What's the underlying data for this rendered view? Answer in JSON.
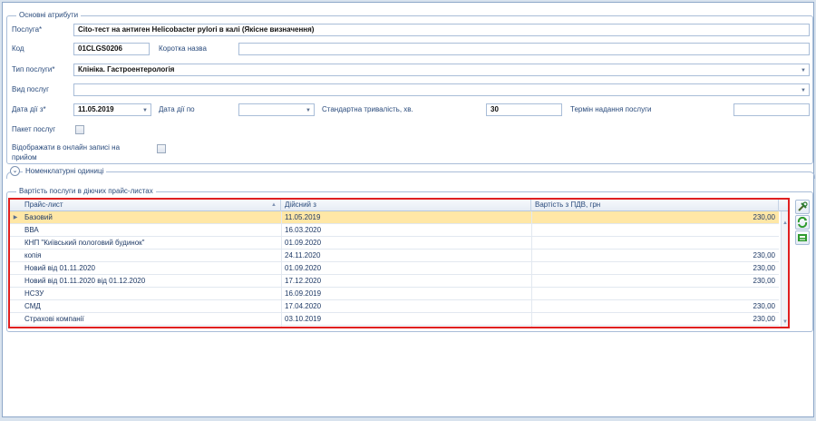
{
  "attributes": {
    "group_title": "Основні атрибути",
    "service": {
      "label": "Послуга*",
      "value": "Cito-тест на антиген Helicobacter pylori в калі (Якісне визначення)"
    },
    "code": {
      "label": "Код",
      "value": "01CLGS0206"
    },
    "short_name": {
      "label": "Коротка назва",
      "value": ""
    },
    "service_type": {
      "label": "Тип послуги*",
      "value": "Клініка. Гастроентерологія"
    },
    "service_kind": {
      "label": "Вид послуг",
      "value": ""
    },
    "date_from": {
      "label": "Дата дії з*",
      "value": "11.05.2019"
    },
    "date_to": {
      "label": "Дата дії по",
      "value": ""
    },
    "std_duration": {
      "label": "Стандартна тривалість, хв.",
      "value": "30"
    },
    "term": {
      "label": "Термін надання послуги",
      "value": ""
    },
    "package": {
      "label": "Пакет послуг",
      "checked": false
    },
    "online": {
      "label_line1": "Відображати в онлайн записі на",
      "label_line2": "прийом",
      "checked": false
    }
  },
  "nomenclature": {
    "title": "Номенклатурні одиниці",
    "icon": "chevron-down-icon"
  },
  "prices": {
    "group_title": "Вартість послуги в діючих прайс-листах",
    "columns": [
      "Прайс-лист",
      "Дійсний з",
      "Вартість з ПДВ, грн"
    ],
    "rows": [
      {
        "name": "Базовий",
        "date": "11.05.2019",
        "price": "230,00",
        "selected": true
      },
      {
        "name": "ВВА",
        "date": "16.03.2020",
        "price": ""
      },
      {
        "name": "КНП \"Київський пологовий будинок\"",
        "date": "01.09.2020",
        "price": ""
      },
      {
        "name": "копія",
        "date": "24.11.2020",
        "price": "230,00"
      },
      {
        "name": "Новий від 01.11.2020",
        "date": "01.09.2020",
        "price": "230,00"
      },
      {
        "name": "Новий від 01.11.2020 від 01.12.2020",
        "date": "17.12.2020",
        "price": "230,00"
      },
      {
        "name": "НСЗУ",
        "date": "16.09.2019",
        "price": ""
      },
      {
        "name": "СМД",
        "date": "17.04.2020",
        "price": "230,00"
      },
      {
        "name": "Страхові компанії",
        "date": "03.10.2019",
        "price": "230,00"
      }
    ],
    "side_buttons": [
      "tools-icon",
      "refresh-icon",
      "export-icon"
    ]
  },
  "colors": {
    "accent": "#e02020",
    "selected_row": "#ffe7a6",
    "label": "#2a4b7c"
  }
}
